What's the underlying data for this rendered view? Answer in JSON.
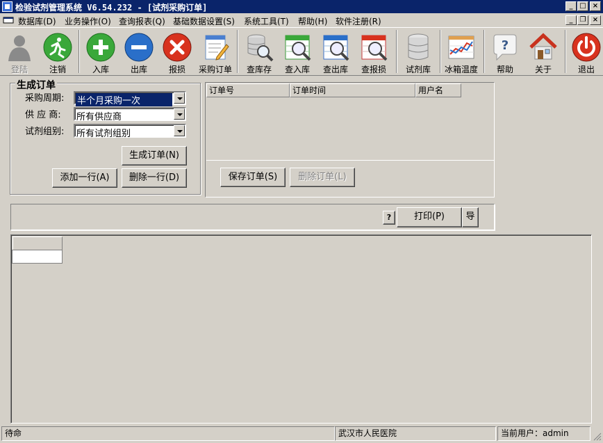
{
  "window": {
    "title": "检验试剂管理系统 V6.54.232 - [试剂采购订单]"
  },
  "menu": [
    {
      "label": "数据库(D)"
    },
    {
      "label": "业务操作(O)"
    },
    {
      "label": "查询报表(Q)"
    },
    {
      "label": "基础数据设置(S)"
    },
    {
      "label": "系统工具(T)"
    },
    {
      "label": "帮助(H)"
    },
    {
      "label": "软件注册(R)"
    }
  ],
  "toolbar": [
    {
      "label": "登陆",
      "icon": "user-silhouette-icon",
      "enabled": false
    },
    {
      "label": "注销",
      "icon": "running-man-icon",
      "enabled": true
    },
    {
      "label": "入库",
      "icon": "plus-circle-icon",
      "enabled": true
    },
    {
      "label": "出库",
      "icon": "minus-circle-icon",
      "enabled": true
    },
    {
      "label": "报损",
      "icon": "x-circle-icon",
      "enabled": true
    },
    {
      "label": "采购订单",
      "icon": "notepad-pencil-icon",
      "enabled": true
    },
    {
      "label": "查库存",
      "icon": "database-magnifier-icon",
      "enabled": true
    },
    {
      "label": "查入库",
      "icon": "green-sheet-magnifier-icon",
      "enabled": true
    },
    {
      "label": "查出库",
      "icon": "blue-sheet-magnifier-icon",
      "enabled": true
    },
    {
      "label": "查报损",
      "icon": "red-sheet-magnifier-icon",
      "enabled": true
    },
    {
      "label": "试剂库",
      "icon": "database-icon",
      "enabled": true
    },
    {
      "label": "冰箱温度",
      "icon": "chart-icon",
      "enabled": true
    },
    {
      "label": "帮助",
      "icon": "help-bubble-icon",
      "enabled": true
    },
    {
      "label": "关于",
      "icon": "house-icon",
      "enabled": true
    },
    {
      "label": "退出",
      "icon": "power-icon",
      "enabled": true
    }
  ],
  "generate": {
    "legend": "生成订单",
    "period_label": "采购周期:",
    "period_value": "半个月采购一次",
    "supplier_label": "供 应 商:",
    "supplier_value": "所有供应商",
    "group_label": "试剂组别:",
    "group_value": "所有试剂组别",
    "generate_btn": "生成订单(N)",
    "add_row_btn": "添加一行(A)",
    "del_row_btn": "删除一行(D)"
  },
  "orders": {
    "columns": [
      "订单号",
      "订单时间",
      "用户名"
    ],
    "save_btn": "保存订单(S)",
    "delete_btn": "删除订单(L)"
  },
  "print_bar": {
    "help_btn": "?",
    "print_btn": "打印(P)",
    "export_btn": "导"
  },
  "status": {
    "left": "待命",
    "hospital": "武汉市人民医院",
    "user": "当前用户：admin"
  },
  "colors": {
    "titlebar": "#0a246a",
    "face": "#d4d0c8"
  }
}
